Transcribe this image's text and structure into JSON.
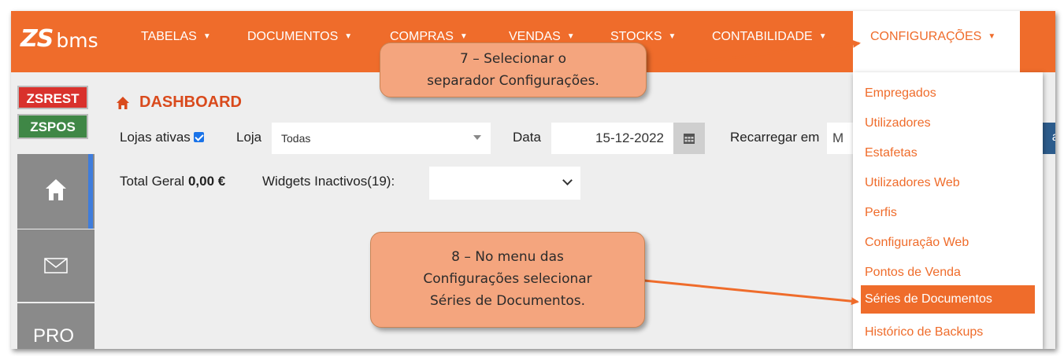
{
  "app": {
    "logo_mark": "ZS",
    "logo_text": "bms"
  },
  "nav": {
    "items": [
      {
        "label": "TABELAS"
      },
      {
        "label": "DOCUMENTOS"
      },
      {
        "label": "COMPRAS"
      },
      {
        "label": "VENDAS"
      },
      {
        "label": "STOCKS"
      },
      {
        "label": "CONTABILIDADE"
      }
    ],
    "active": {
      "label": "CONFIGURAÇÕES"
    },
    "caret": "▼"
  },
  "sidebar": {
    "badge_rest": "ZSREST",
    "badge_pos": "ZSPOS",
    "pro_label": "PRO"
  },
  "dashboard": {
    "title": "DASHBOARD",
    "lojas_ativas_label": "Lojas ativas",
    "loja_label": "Loja",
    "loja_value": "Todas",
    "data_label": "Data",
    "data_value": "15-12-2022",
    "recarregar_label": "Recarregar em",
    "recarregar_value": "M",
    "edge_text": "ar",
    "total_label": "Total Geral",
    "total_value": "0,00 €",
    "widgets_label": "Widgets Inactivos(19):"
  },
  "menu": {
    "items": [
      {
        "label": "Empregados"
      },
      {
        "label": "Utilizadores"
      },
      {
        "label": "Estafetas"
      },
      {
        "label": "Utilizadores Web"
      },
      {
        "label": "Perfis"
      },
      {
        "label": "Configuração Web"
      },
      {
        "label": "Pontos de Venda"
      },
      {
        "label": "Séries de Documentos"
      },
      {
        "label": "Histórico de Backups"
      }
    ],
    "active_index": 7
  },
  "callouts": {
    "step7": [
      "7 – Selecionar o",
      "separador Configurações."
    ],
    "step8": [
      "8 – No menu das",
      "Configurações selecionar",
      "Séries de Documentos."
    ]
  },
  "colors": {
    "brand_orange": "#ef6c2b",
    "callout_fill": "#f4a57e",
    "zsrest_red": "#d9312c",
    "zspos_green": "#3f8746",
    "sidebar_gray": "#8a8a8a",
    "accent_blue": "#3f7ddc"
  },
  "icons": [
    "home-icon",
    "mail-icon",
    "calendar-icon",
    "dropdown-arrow-icon",
    "checkbox-checked-icon"
  ]
}
